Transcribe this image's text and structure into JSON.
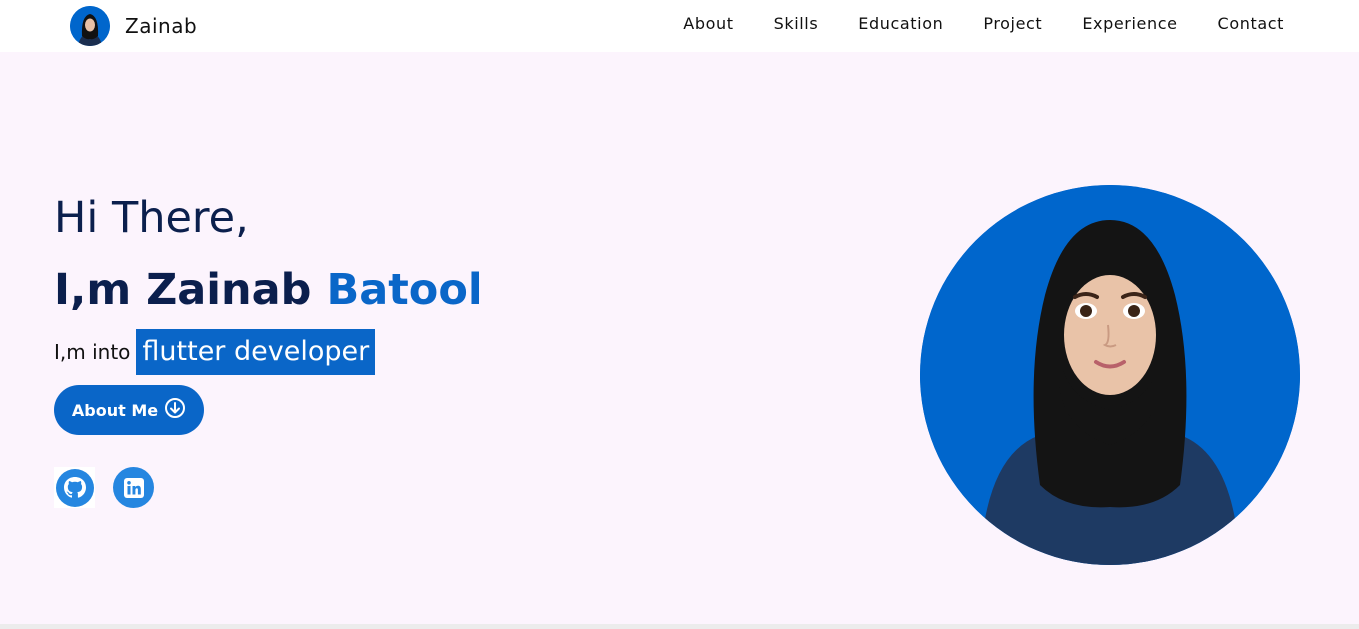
{
  "header": {
    "brand_name": "Zainab",
    "nav": [
      "About",
      "Skills",
      "Education",
      "Project",
      "Experience",
      "Contact"
    ]
  },
  "hero": {
    "greeting": "Hi There,",
    "name_prefix": "I,m Zainab ",
    "name_accent": "Batool",
    "role_prefix": "I,m into",
    "role_highlight": "flutter developer",
    "about_button": "About Me"
  },
  "icons": {
    "avatar": "avatar-icon",
    "about_arrow": "arrow-down-circle-icon",
    "github": "github-icon",
    "linkedin": "linkedin-icon"
  },
  "colors": {
    "primary": "#0a66c8",
    "heading": "#0b1f4d",
    "background": "#fcf4fd"
  }
}
